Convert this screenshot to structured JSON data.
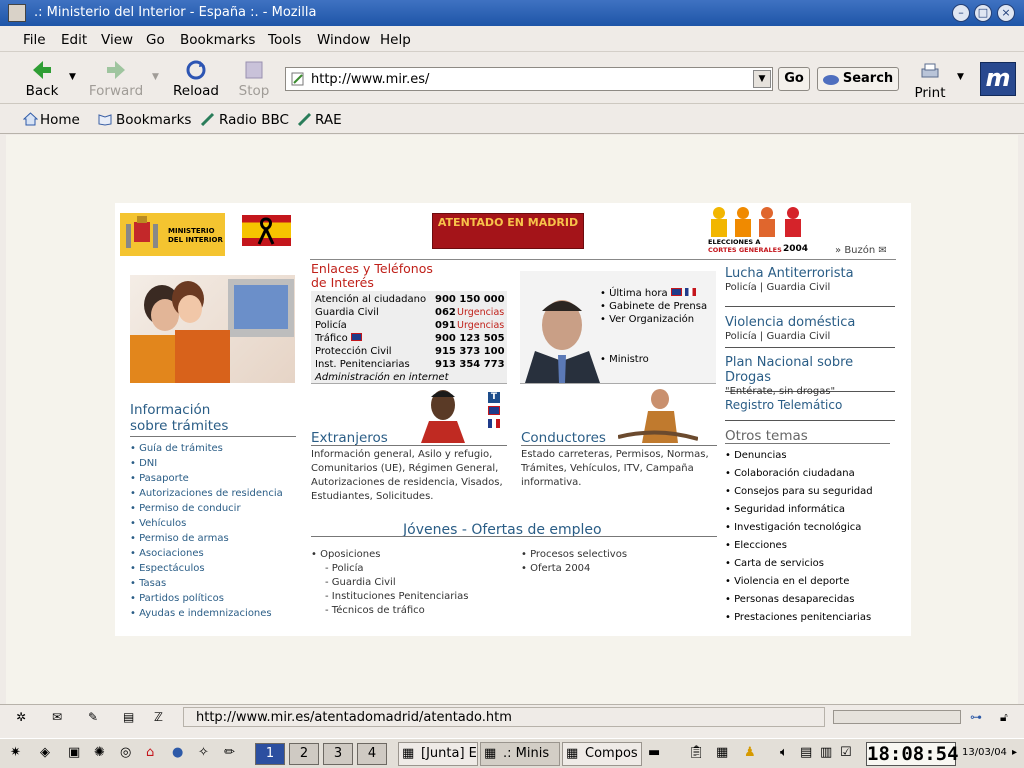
{
  "window": {
    "title": ".: Ministerio del Interior - España :. - Mozilla"
  },
  "menu": [
    "File",
    "Edit",
    "View",
    "Go",
    "Bookmarks",
    "Tools",
    "Window",
    "Help"
  ],
  "toolbar": {
    "back": "Back",
    "forward": "Forward",
    "reload": "Reload",
    "stop": "Stop",
    "url": "http://www.mir.es/",
    "go": "Go",
    "search": "Search",
    "print": "Print"
  },
  "bookmarks": [
    "Home",
    "Bookmarks",
    "Radio BBC",
    "RAE"
  ],
  "page": {
    "ministry_logo": [
      "MINISTERIO",
      "DEL INTERIOR"
    ],
    "banner": "ATENTADO EN MADRID",
    "elecciones": [
      "ELECCIONES A",
      "CORTES GENERALES",
      "2004"
    ],
    "buzon": "Buzón",
    "enlaces_title": [
      "Enlaces y Teléfonos",
      "de Interés"
    ],
    "phones": [
      {
        "label": "Atención al ciudadano",
        "num": "900 150 000",
        "extra": ""
      },
      {
        "label": "Guardia Civil",
        "num": "062",
        "extra": "Urgencias"
      },
      {
        "label": "Policía",
        "num": "091",
        "extra": "Urgencias"
      },
      {
        "label": "Tráfico",
        "num": "900 123 505",
        "extra": ""
      },
      {
        "label": "Protección Civil",
        "num": "915 373 100",
        "extra": ""
      },
      {
        "label": "Inst. Penitenciarias",
        "num": "913 354 773",
        "extra": ""
      }
    ],
    "admin_internet": "Administración en internet",
    "ministro_links": [
      "Última hora",
      "Gabinete de Prensa",
      "Ver Organización",
      "Ministro"
    ],
    "right_sections": [
      {
        "title": "Lucha Antiterrorista",
        "sub": "Policía | Guardia Civil"
      },
      {
        "title": "Violencia doméstica",
        "sub": "Policía | Guardia Civil"
      },
      {
        "title": "Plan Nacional sobre Drogas",
        "sub": "\"Entérate, sin drogas\""
      },
      {
        "title": "Registro Telemático",
        "sub": ""
      }
    ],
    "info_title": [
      "Información",
      "sobre trámites"
    ],
    "tramites": [
      "Guía de trámites",
      "DNI",
      "Pasaporte",
      "Autorizaciones de residencia",
      "Permiso de conducir",
      "Vehículos",
      "Permiso de armas",
      "Asociaciones",
      "Espectáculos",
      "Tasas",
      "Partidos políticos",
      "Ayudas e indemnizaciones"
    ],
    "extranjeros": {
      "title": "Extranjeros",
      "text": [
        "Información general, Asilo y refugio,",
        "Comunitarios (UE), Régimen General,",
        "Autorizaciones de residencia, Visados,",
        "Estudiantes, Solicitudes."
      ]
    },
    "conductores": {
      "title": "Conductores",
      "text": [
        "Estado carreteras, Permisos, Normas,",
        "Trámites, Vehículos, ITV, Campaña",
        "informativa."
      ]
    },
    "jovenes_title": "Jóvenes - Ofertas de empleo",
    "jovenes_left": [
      "Oposiciones",
      "Policía",
      "Guardia Civil",
      "Instituciones Penitenciarias",
      "Técnicos de tráfico"
    ],
    "jovenes_right": [
      "Procesos selectivos",
      "Oferta 2004"
    ],
    "otros_title": "Otros temas",
    "otros": [
      "Denuncias",
      "Colaboración ciudadana",
      "Consejos para su seguridad",
      "Seguridad informática",
      "Investigación tecnológica",
      "Elecciones",
      "Carta de servicios",
      "Violencia en el deporte",
      "Personas desaparecidas",
      "Prestaciones penitenciarias"
    ]
  },
  "status": {
    "url": "http://www.mir.es/atentadomadrid/atentado.htm"
  },
  "taskbar": {
    "workspaces": [
      "1",
      "2",
      "3",
      "4"
    ],
    "tasks": [
      "[Junta] E",
      ".: Minis",
      "Compos"
    ],
    "clock": "18:08:54",
    "date": "13/03/04"
  }
}
